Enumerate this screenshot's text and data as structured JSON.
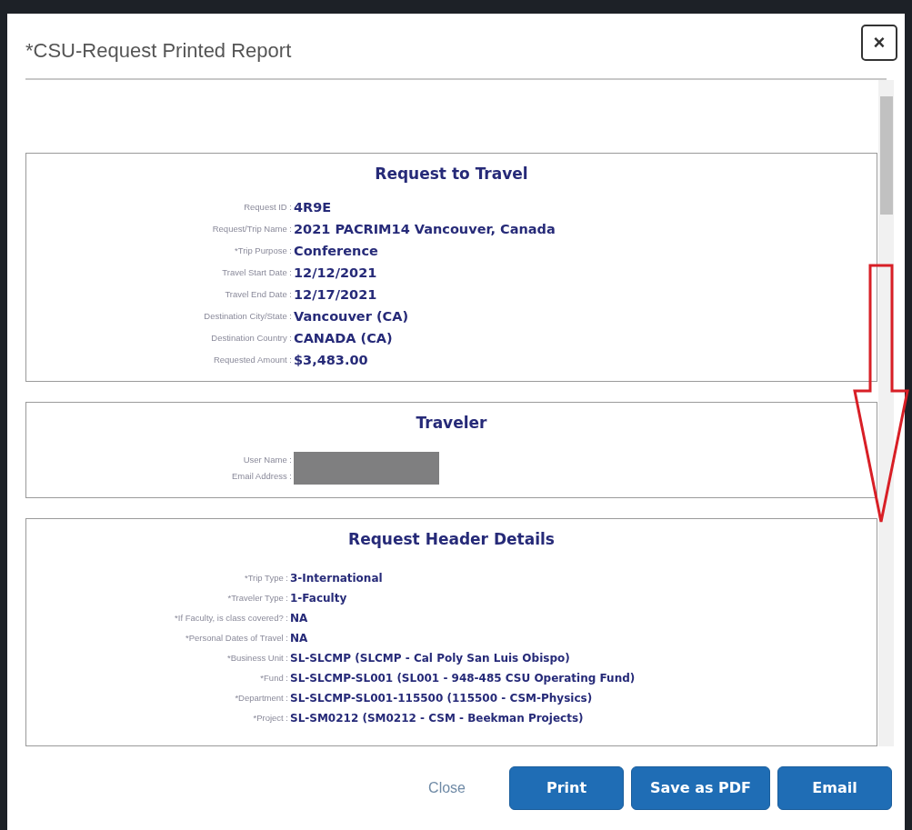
{
  "dialog": {
    "title": "*CSU-Request Printed Report",
    "close_icon": "×"
  },
  "sections": [
    {
      "title": "Request to Travel",
      "fields": [
        {
          "label": "Request ID :",
          "value": "4R9E"
        },
        {
          "label": "Request/Trip Name :",
          "value": "2021 PACRIM14 Vancouver, Canada"
        },
        {
          "label": "*Trip Purpose :",
          "value": "Conference"
        },
        {
          "label": "Travel Start Date :",
          "value": "12/12/2021"
        },
        {
          "label": "Travel End Date :",
          "value": "12/17/2021"
        },
        {
          "label": "Destination City/State :",
          "value": "Vancouver (CA)"
        },
        {
          "label": "Destination Country :",
          "value": "CANADA (CA)"
        },
        {
          "label": "Requested Amount :",
          "value": "$3,483.00"
        }
      ]
    },
    {
      "title": "Traveler",
      "fields": [
        {
          "label": "User Name :",
          "redacted": true
        },
        {
          "label": "Email Address :",
          "redacted": true
        }
      ]
    },
    {
      "title": "Request Header Details",
      "fields": [
        {
          "label": "*Trip Type :",
          "value": "3-International"
        },
        {
          "label": "*Traveler Type :",
          "value": "1-Faculty"
        },
        {
          "label": "*If Faculty, is class covered? :",
          "value": "NA"
        },
        {
          "label": "*Personal Dates of Travel :",
          "value": "NA"
        },
        {
          "label": "*Business Unit :",
          "value": "SL-SLCMP (SLCMP - Cal Poly San Luis Obispo)"
        },
        {
          "label": "*Fund :",
          "value": "SL-SLCMP-SL001 (SL001 - 948-485 CSU Operating Fund)"
        },
        {
          "label": "*Department :",
          "value": "SL-SLCMP-SL001-115500 (115500 - CSM-Physics)"
        },
        {
          "label": "*Project :",
          "value": "SL-SM0212 (SM0212 - CSM - Beekman Projects)"
        }
      ]
    }
  ],
  "buttons": [
    {
      "label": "Close",
      "kind": "link"
    },
    {
      "label": "Print",
      "kind": "primary"
    },
    {
      "label": "Save as PDF",
      "kind": "primary"
    },
    {
      "label": "Email",
      "kind": "primary"
    }
  ]
}
